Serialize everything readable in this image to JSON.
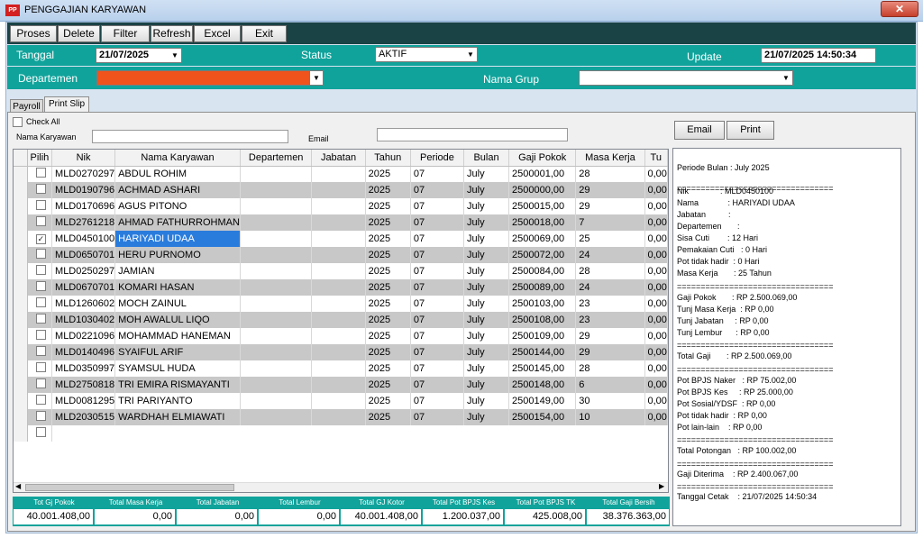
{
  "window": {
    "title": "PENGGAJIAN KARYAWAN",
    "icon_text": "PP",
    "close": "✕"
  },
  "toolbar": [
    "Proses",
    "Delete",
    "Filter",
    "Refresh",
    "Excel",
    "Exit"
  ],
  "filters": {
    "tanggal_label": "Tanggal",
    "tanggal_value": "21/07/2025",
    "status_label": "Status",
    "status_value": "AKTIF",
    "update_label": "Update",
    "update_value": "21/07/2025 14:50:34",
    "departemen_label": "Departemen",
    "departemen_value": "",
    "nama_grup_label": "Nama Grup",
    "nama_grup_value": "",
    "departemen_color": "#f0531b"
  },
  "tabs": [
    "Payroll",
    "Print Slip"
  ],
  "check_all": "Check All",
  "nama_karyawan_label": "Nama Karyawan",
  "email_label": "Email",
  "buttons": {
    "email": "Email",
    "print": "Print"
  },
  "grid": {
    "columns": [
      "Pilih",
      "Nik",
      "Nama Karyawan",
      "Departemen",
      "Jabatan",
      "Tahun",
      "Periode",
      "Bulan",
      "Gaji Pokok",
      "Masa Kerja",
      "Tu"
    ],
    "rows": [
      {
        "nik": "MLD0270297",
        "nama": "ABDUL ROHIM",
        "tahun": "2025",
        "periode": "07",
        "bulan": "July",
        "gaji": "2500001,00",
        "masa": "28",
        "tu": "0,00",
        "checked": false
      },
      {
        "nik": "MLD0190796",
        "nama": "ACHMAD ASHARI",
        "tahun": "2025",
        "periode": "07",
        "bulan": "July",
        "gaji": "2500000,00",
        "masa": "29",
        "tu": "0,00",
        "checked": false
      },
      {
        "nik": "MLD0170696",
        "nama": "AGUS PITONO",
        "tahun": "2025",
        "periode": "07",
        "bulan": "July",
        "gaji": "2500015,00",
        "masa": "29",
        "tu": "0,00",
        "checked": false
      },
      {
        "nik": "MLD2761218",
        "nama": "AHMAD FATHURROHMAN",
        "tahun": "2025",
        "periode": "07",
        "bulan": "July",
        "gaji": "2500018,00",
        "masa": "7",
        "tu": "0,00",
        "checked": false
      },
      {
        "nik": "MLD0450100",
        "nama": "HARIYADI UDAA",
        "tahun": "2025",
        "periode": "07",
        "bulan": "July",
        "gaji": "2500069,00",
        "masa": "25",
        "tu": "0,00",
        "checked": true
      },
      {
        "nik": "MLD0650701",
        "nama": "HERU PURNOMO",
        "tahun": "2025",
        "periode": "07",
        "bulan": "July",
        "gaji": "2500072,00",
        "masa": "24",
        "tu": "0,00",
        "checked": false
      },
      {
        "nik": "MLD0250297",
        "nama": "JAMIAN",
        "tahun": "2025",
        "periode": "07",
        "bulan": "July",
        "gaji": "2500084,00",
        "masa": "28",
        "tu": "0,00",
        "checked": false
      },
      {
        "nik": "MLD0670701",
        "nama": "KOMARI HASAN",
        "tahun": "2025",
        "periode": "07",
        "bulan": "July",
        "gaji": "2500089,00",
        "masa": "24",
        "tu": "0,00",
        "checked": false
      },
      {
        "nik": "MLD1260602",
        "nama": "MOCH ZAINUL",
        "tahun": "2025",
        "periode": "07",
        "bulan": "July",
        "gaji": "2500103,00",
        "masa": "23",
        "tu": "0,00",
        "checked": false
      },
      {
        "nik": "MLD1030402",
        "nama": "MOH AWALUL LIQO",
        "tahun": "2025",
        "periode": "07",
        "bulan": "July",
        "gaji": "2500108,00",
        "masa": "23",
        "tu": "0,00",
        "checked": false
      },
      {
        "nik": "MLD0221096",
        "nama": "MOHAMMAD HANEMAN",
        "tahun": "2025",
        "periode": "07",
        "bulan": "July",
        "gaji": "2500109,00",
        "masa": "29",
        "tu": "0,00",
        "checked": false
      },
      {
        "nik": "MLD0140496",
        "nama": "SYAIFUL ARIF",
        "tahun": "2025",
        "periode": "07",
        "bulan": "July",
        "gaji": "2500144,00",
        "masa": "29",
        "tu": "0,00",
        "checked": false
      },
      {
        "nik": "MLD0350997",
        "nama": "SYAMSUL HUDA",
        "tahun": "2025",
        "periode": "07",
        "bulan": "July",
        "gaji": "2500145,00",
        "masa": "28",
        "tu": "0,00",
        "checked": false
      },
      {
        "nik": "MLD2750818",
        "nama": "TRI EMIRA RISMAYANTI",
        "tahun": "2025",
        "periode": "07",
        "bulan": "July",
        "gaji": "2500148,00",
        "masa": "6",
        "tu": "0,00",
        "checked": false
      },
      {
        "nik": "MLD0081295",
        "nama": "TRI PARIYANTO",
        "tahun": "2025",
        "periode": "07",
        "bulan": "July",
        "gaji": "2500149,00",
        "masa": "30",
        "tu": "0,00",
        "checked": false
      },
      {
        "nik": "MLD2030515",
        "nama": "WARDHAH ELMIAWATI",
        "tahun": "2025",
        "periode": "07",
        "bulan": "July",
        "gaji": "2500154,00",
        "masa": "10",
        "tu": "0,00",
        "checked": false
      }
    ],
    "selected_index": 4
  },
  "totals": [
    {
      "label": "Tot Gj Pokok",
      "value": "40.001.408,00"
    },
    {
      "label": "Total Masa Kerja",
      "value": "0,00"
    },
    {
      "label": "Total Jabatan",
      "value": "0,00"
    },
    {
      "label": "Total Lembur",
      "value": "0,00"
    },
    {
      "label": "Total GJ Kotor",
      "value": "40.001.408,00"
    },
    {
      "label": "Total Pot BPJS Kes",
      "value": "1.200.037,00"
    },
    {
      "label": "Total Pot BPJS TK",
      "value": "425.008,00"
    },
    {
      "label": "Total Gaji Bersih",
      "value": "38.376.363,00"
    }
  ],
  "slip": [
    "Periode Bulan : July 2025",
    "=================================",
    "Nik              : MLD0450100",
    "Nama             : HARIYADI UDAA",
    "Jabatan          :",
    "Departemen       :",
    "Sisa Cuti        : 12 Hari",
    "Pemakaian Cuti   : 0 Hari",
    "Pot tidak hadir  : 0 Hari",
    "Masa Kerja       : 25 Tahun",
    "=================================",
    "Gaji Pokok       : RP 2.500.069,00",
    "Tunj Masa Kerja  : RP 0,00",
    "Tunj Jabatan     : RP 0,00",
    "Tunj Lembur      : RP 0,00",
    "=================================",
    "Total Gaji       : RP 2.500.069,00",
    "=================================",
    "Pot BPJS Naker   : RP 75.002,00",
    "Pot BPJS Kes     : RP 25.000,00",
    "Pot Sosial/YDSF  : RP 0,00",
    "Pot tidak hadir  : RP 0,00",
    "Pot lain-lain    : RP 0,00",
    "=================================",
    "Total Potongan   : RP 100.002,00",
    "=================================",
    "Gaji Diterima    : RP 2.400.067,00",
    "=================================",
    "Tanggal Cetak    : 21/07/2025 14:50:34"
  ]
}
